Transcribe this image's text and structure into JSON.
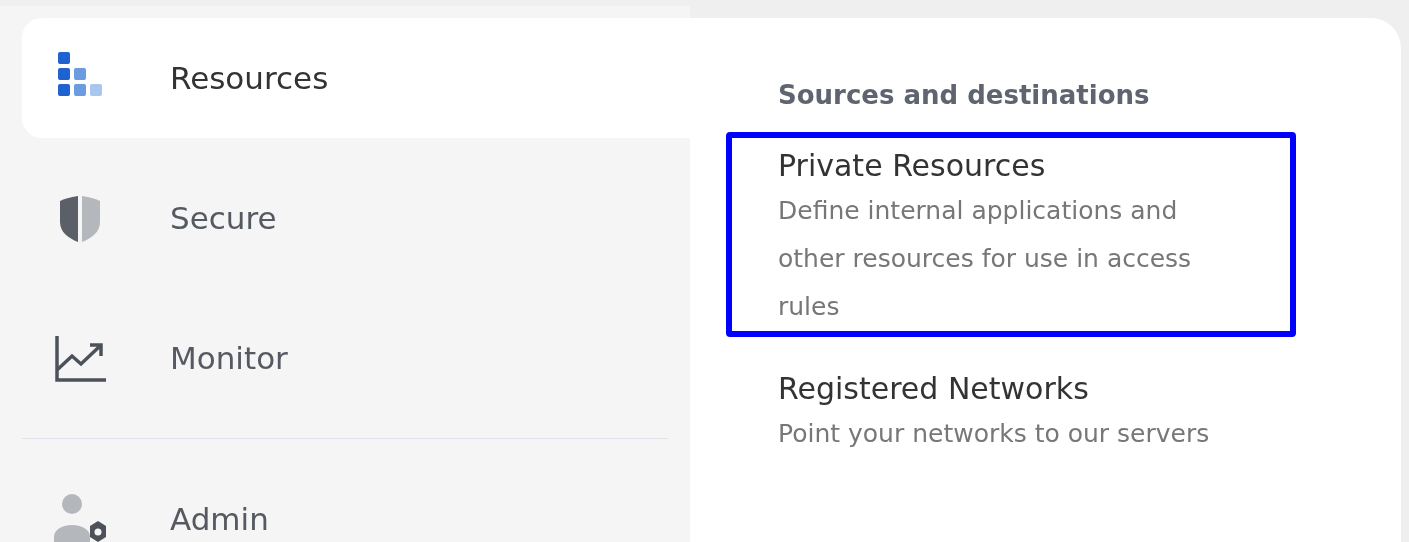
{
  "sidebar": {
    "items": [
      {
        "label": "Resources",
        "kind": "blocks",
        "selected": true
      },
      {
        "label": "Secure",
        "kind": "shield",
        "selected": false
      },
      {
        "label": "Monitor",
        "kind": "chart",
        "selected": false
      },
      {
        "label": "Admin",
        "kind": "admin",
        "selected": false,
        "divider_before": true
      }
    ]
  },
  "menu": {
    "heading": "Sources and destinations",
    "items": [
      {
        "title": "Private Resources",
        "description": "Define internal applications and other resources for use in access rules",
        "highlighted": true
      },
      {
        "title": "Registered Networks",
        "description": "Point your networks to our servers",
        "highlighted": false
      }
    ]
  }
}
